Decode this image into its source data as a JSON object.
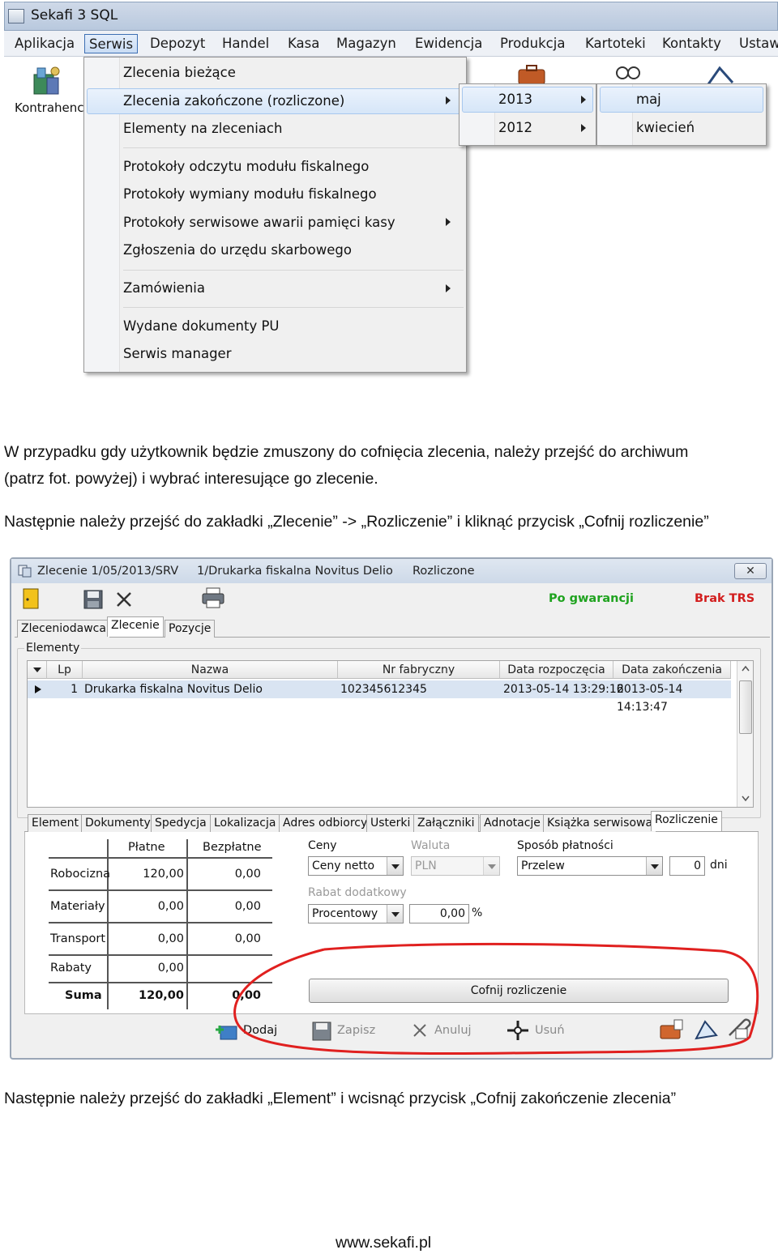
{
  "menu_screenshot": {
    "app_title": "Sekafi 3 SQL",
    "menubar": [
      "Aplikacja",
      "Serwis",
      "Depozyt",
      "Handel",
      "Kasa",
      "Magazyn",
      "Ewidencja",
      "Produkcja",
      "Kartoteki",
      "Kontakty",
      "Ustaw"
    ],
    "active_menu": "Serwis",
    "toolbar_label": "Kontrahenc",
    "serwis_menu": [
      "Zlecenia bieżące",
      "Zlecenia zakończone (rozliczone)",
      "Elementy na zleceniach",
      "Protokoły odczytu modułu fiskalnego",
      "Protokoły wymiany modułu fiskalnego",
      "Protokoły serwisowe awarii pamięci kasy",
      "Zgłoszenia do urzędu skarbowego",
      "Zamówienia",
      "Wydane dokumenty PU",
      "Serwis manager"
    ],
    "years_menu": [
      "2013",
      "2012"
    ],
    "months_menu": [
      "maj",
      "kwiecień"
    ]
  },
  "text": {
    "para1_line1": "W przypadku gdy użytkownik będzie zmuszony do cofnięcia zlecenia, należy przejść do archiwum",
    "para1_line2": "(patrz fot. powyżej) i wybrać interesujące go zlecenie.",
    "para2": "Następnie należy przejść do zakładki „Zlecenie” -> „Rozliczenie” i kliknąć przycisk „Cofnij rozliczenie”",
    "para3": "Następnie należy przejść do zakładki „Element” i wcisnąć przycisk „Cofnij zakończenie zlecenia”",
    "footer": "www.sekafi.pl"
  },
  "zlecenie_window": {
    "title_number": "Zlecenie 1/05/2013/SRV",
    "title_device": "1/Drukarka fiskalna Novitus Delio",
    "title_status": "Rozliczone",
    "close_label": "✕",
    "status_warranty": "Po gwarancji",
    "status_trs": "Brak TRS",
    "top_tabs": [
      "Zleceniodawca",
      "Zlecenie",
      "Pozycje"
    ],
    "group_label": "Elementy",
    "grid_headers": [
      "Lp",
      "Nazwa",
      "Nr fabryczny",
      "Data rozpoczęcia",
      "Data zakończenia"
    ],
    "grid_row": {
      "lp": "1",
      "nazwa": "Drukarka fiskalna Novitus Delio",
      "nr": "102345612345",
      "start": "2013-05-14 13:29:16",
      "end": "2013-05-14 14:13:47"
    },
    "bottom_tabs": [
      "Element",
      "Dokumenty",
      "Spedycja",
      "Lokalizacja",
      "Adres odbiorcy",
      "Usterki",
      "Załączniki",
      "Adnotacje",
      "Książka serwisowa",
      "Rozliczenie"
    ],
    "cost_table": {
      "col_platne": "Płatne",
      "col_bezplatne": "Bezpłatne",
      "rows": [
        {
          "label": "Robocizna",
          "platne": "120,00",
          "bezplatne": "0,00"
        },
        {
          "label": "Materiały",
          "platne": "0,00",
          "bezplatne": "0,00"
        },
        {
          "label": "Transport",
          "platne": "0,00",
          "bezplatne": "0,00"
        },
        {
          "label": "Rabaty",
          "platne": "0,00",
          "bezplatne": ""
        },
        {
          "label": "Suma",
          "platne": "120,00",
          "bezplatne": "0,00"
        }
      ]
    },
    "ceny_label": "Ceny",
    "ceny_value": "Ceny netto",
    "waluta_label": "Waluta",
    "waluta_value": "PLN",
    "sposob_label": "Sposób płatności",
    "sposob_value": "Przelew",
    "dni_value": "0",
    "dni_label": "dni",
    "rabat_label": "Rabat dodatkowy",
    "rabat_type": "Procentowy",
    "rabat_value": "0,00",
    "rabat_unit": "%",
    "cofnij_button": "Cofnij rozliczenie",
    "actions": [
      "Dodaj",
      "Zapisz",
      "Anuluj",
      "Usuń"
    ]
  }
}
